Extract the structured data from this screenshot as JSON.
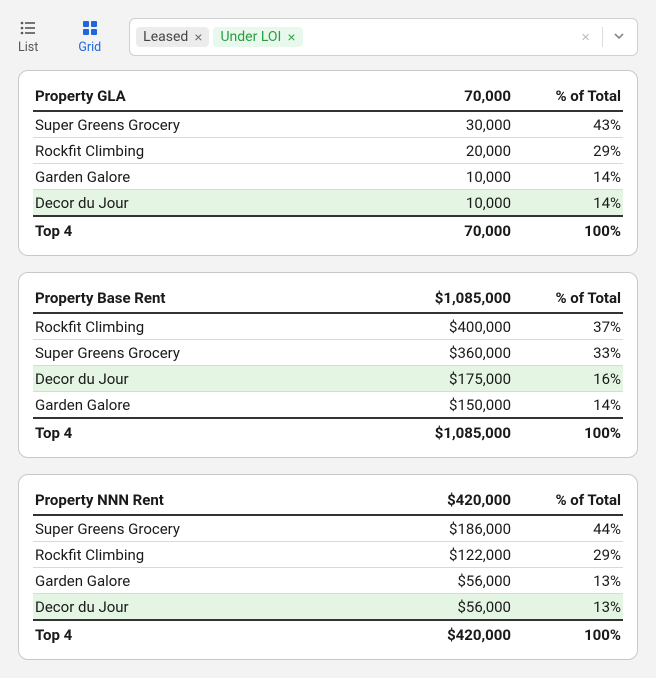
{
  "view": {
    "list_label": "List",
    "grid_label": "Grid",
    "active": "grid"
  },
  "filters": {
    "chips": [
      {
        "label": "Leased",
        "style": "leased"
      },
      {
        "label": "Under LOI",
        "style": "loi"
      }
    ]
  },
  "cards": [
    {
      "title": "Property GLA",
      "total_value": "70,000",
      "pct_header": "% of Total",
      "rows": [
        {
          "label": "Super Greens Grocery",
          "value": "30,000",
          "pct": "43%",
          "highlight": false
        },
        {
          "label": "Rockfit Climbing",
          "value": "20,000",
          "pct": "29%",
          "highlight": false
        },
        {
          "label": "Garden Galore",
          "value": "10,000",
          "pct": "14%",
          "highlight": false
        },
        {
          "label": "Decor du Jour",
          "value": "10,000",
          "pct": "14%",
          "highlight": true
        }
      ],
      "footer": {
        "label": "Top 4",
        "value": "70,000",
        "pct": "100%"
      }
    },
    {
      "title": "Property Base Rent",
      "total_value": "$1,085,000",
      "pct_header": "% of Total",
      "rows": [
        {
          "label": "Rockfit Climbing",
          "value": "$400,000",
          "pct": "37%",
          "highlight": false
        },
        {
          "label": "Super Greens Grocery",
          "value": "$360,000",
          "pct": "33%",
          "highlight": false
        },
        {
          "label": "Decor du Jour",
          "value": "$175,000",
          "pct": "16%",
          "highlight": true
        },
        {
          "label": "Garden Galore",
          "value": "$150,000",
          "pct": "14%",
          "highlight": false
        }
      ],
      "footer": {
        "label": "Top 4",
        "value": "$1,085,000",
        "pct": "100%"
      }
    },
    {
      "title": "Property NNN Rent",
      "total_value": "$420,000",
      "pct_header": "% of Total",
      "rows": [
        {
          "label": "Super Greens Grocery",
          "value": "$186,000",
          "pct": "44%",
          "highlight": false
        },
        {
          "label": "Rockfit Climbing",
          "value": "$122,000",
          "pct": "29%",
          "highlight": false
        },
        {
          "label": "Garden Galore",
          "value": "$56,000",
          "pct": "13%",
          "highlight": false
        },
        {
          "label": "Decor du Jour",
          "value": "$56,000",
          "pct": "13%",
          "highlight": true
        }
      ],
      "footer": {
        "label": "Top 4",
        "value": "$420,000",
        "pct": "100%"
      }
    }
  ]
}
